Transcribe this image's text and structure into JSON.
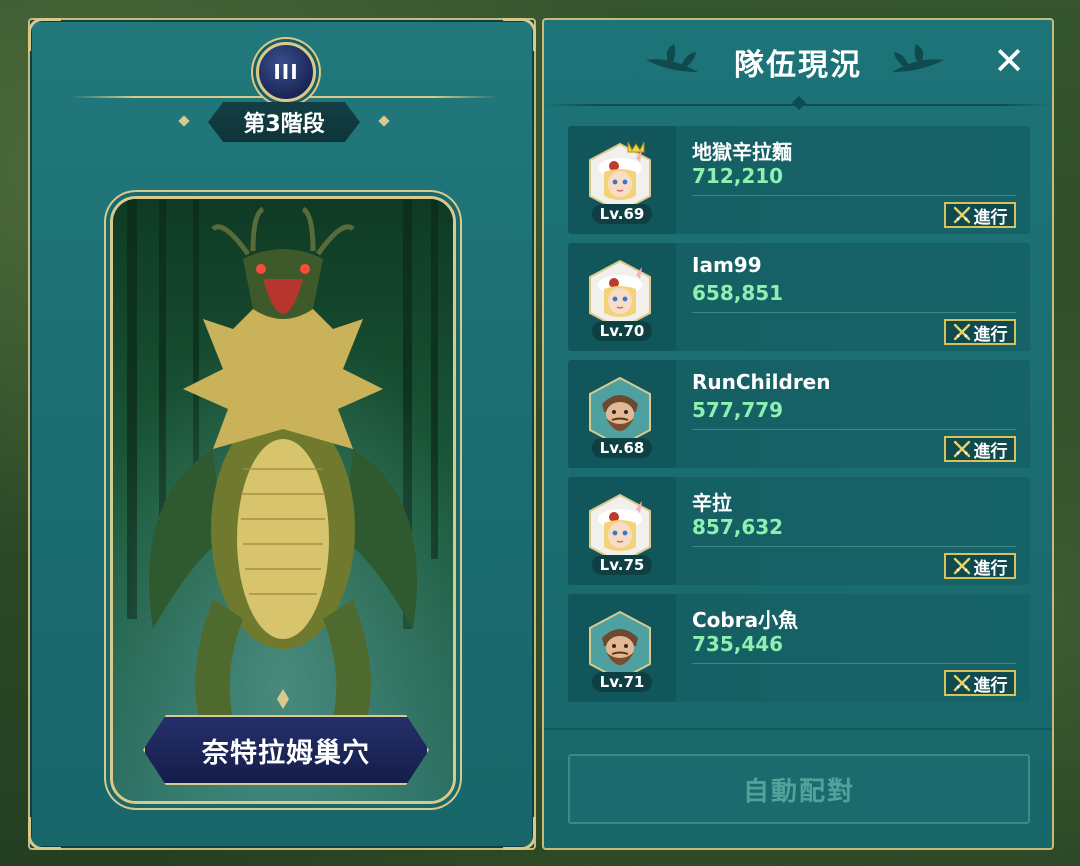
{
  "left_panel": {
    "stage_numeral": "III",
    "stage_label": "第3階段",
    "boss_name": "奈特拉姆巢穴"
  },
  "right_panel": {
    "title": "隊伍現況",
    "close_icon": "close-icon",
    "members": [
      {
        "name": "地獄辛拉麵",
        "power": "712,210",
        "level": "Lv.69",
        "status": "進行",
        "avatar": "female-avatar",
        "leader": true
      },
      {
        "name": "Iam99",
        "power": "658,851",
        "level": "Lv.70",
        "status": "進行",
        "avatar": "female-avatar",
        "leader": false
      },
      {
        "name": "RunChildren",
        "power": "577,779",
        "level": "Lv.68",
        "status": "進行",
        "avatar": "bearded-male-avatar",
        "leader": false
      },
      {
        "name": "辛拉",
        "power": "857,632",
        "level": "Lv.75",
        "status": "進行",
        "avatar": "female-avatar",
        "leader": false
      },
      {
        "name": "Cobra小魚",
        "power": "735,446",
        "level": "Lv.71",
        "status": "進行",
        "avatar": "bearded-male-avatar",
        "leader": false
      }
    ],
    "auto_match_label": "自動配對"
  },
  "colors": {
    "panel": "#1b6d71",
    "gold_trim": "#d9c98c",
    "power_text": "#8ef0b0",
    "status_border": "#d6c15a"
  }
}
